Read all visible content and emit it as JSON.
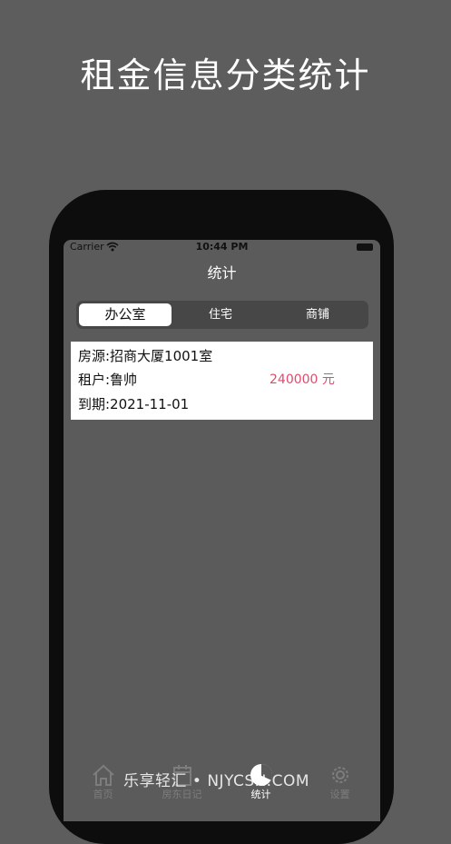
{
  "promo": {
    "headline": "租金信息分类统计"
  },
  "status_bar": {
    "carrier": "Carrier",
    "time": "10:44 PM"
  },
  "nav": {
    "title": "统计"
  },
  "segments": {
    "items": [
      "办公室",
      "住宅",
      "商铺"
    ],
    "selected": "办公室"
  },
  "record": {
    "property": "房源:招商大厦1001室",
    "tenant": "租户:鲁帅",
    "due": "到期:2021-11-01",
    "amount": "240000 元"
  },
  "tab_bar": {
    "items": [
      {
        "label": "首页",
        "icon": "home-icon"
      },
      {
        "label": "房东日记",
        "icon": "calendar-icon"
      },
      {
        "label": "统计",
        "icon": "pie-chart-icon"
      },
      {
        "label": "设置",
        "icon": "gear-icon"
      }
    ],
    "active": "统计"
  },
  "watermark": {
    "text": "乐享轻汇 • NJYCSH.COM"
  },
  "colors": {
    "background": "#5d5d5d",
    "screen": "#5b5b5b",
    "amount": "#e24a6e",
    "tab_inactive": "#7d7d7d",
    "tab_active": "#ffffff"
  }
}
